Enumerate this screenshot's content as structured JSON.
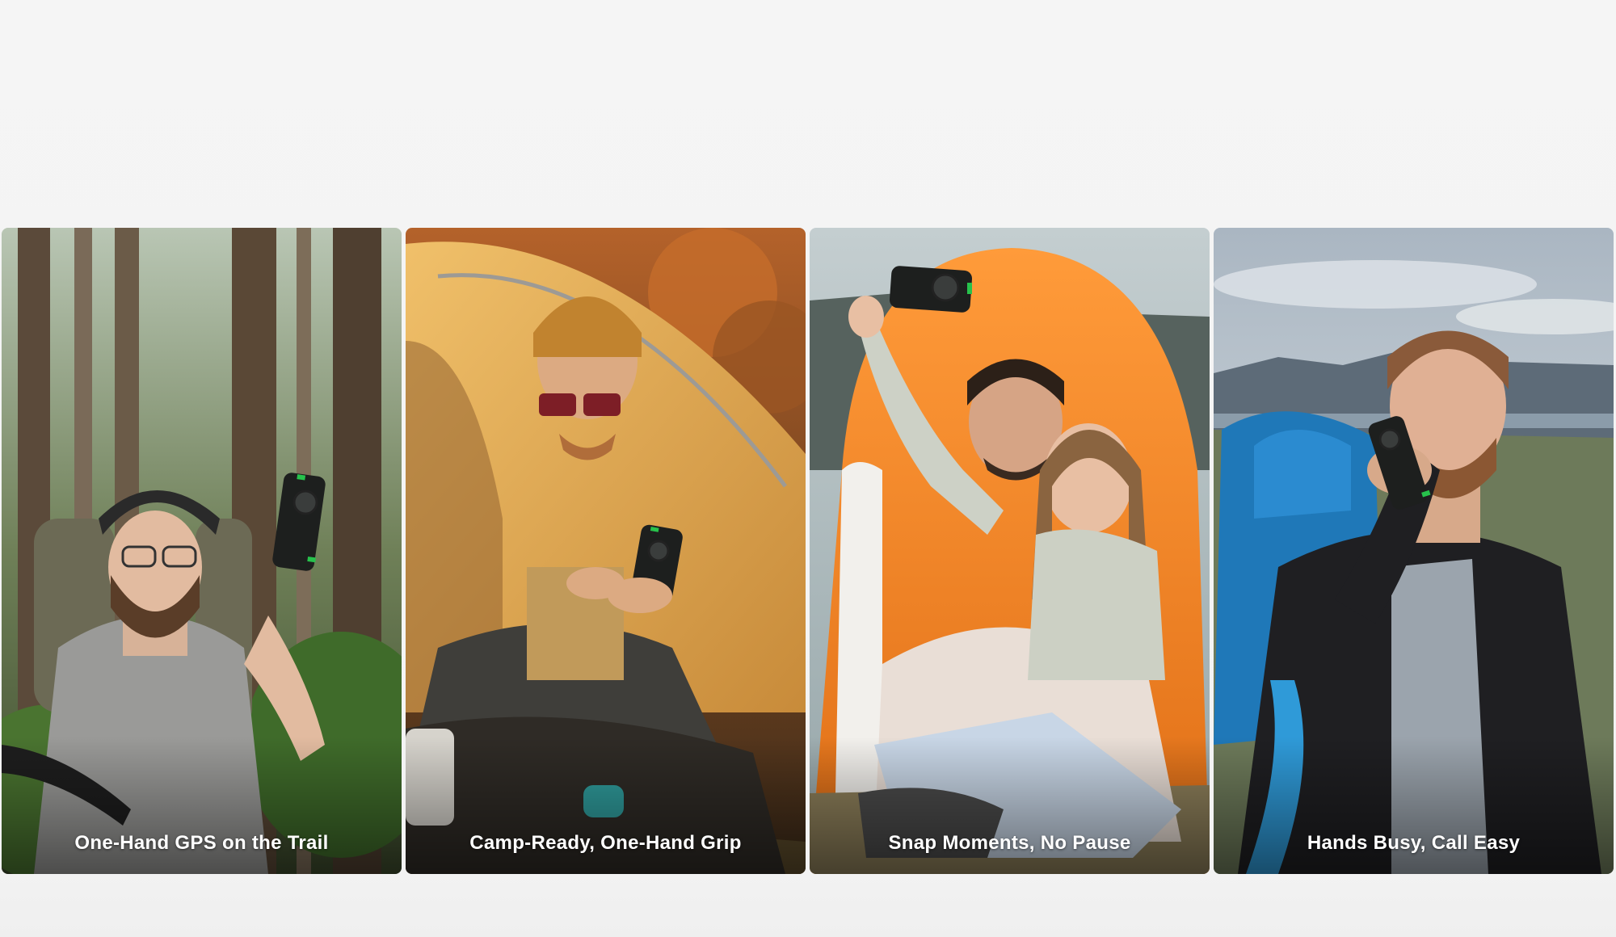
{
  "gallery": {
    "cards": [
      {
        "caption": "One-Hand GPS on the Trail"
      },
      {
        "caption": "Camp-Ready, One-Hand Grip"
      },
      {
        "caption": "Snap Moments, No Pause"
      },
      {
        "caption": "Hands Busy, Call Easy"
      }
    ]
  },
  "colors": {
    "page_background": "#f4f4f4",
    "caption_text": "#ffffff",
    "phone_accent": "#27c24c"
  },
  "icons": {
    "scene_1": "forest-hiker-photo",
    "scene_2": "tent-camper-photo",
    "scene_3": "couple-selfie-photo",
    "scene_4": "backpacker-call-photo"
  }
}
